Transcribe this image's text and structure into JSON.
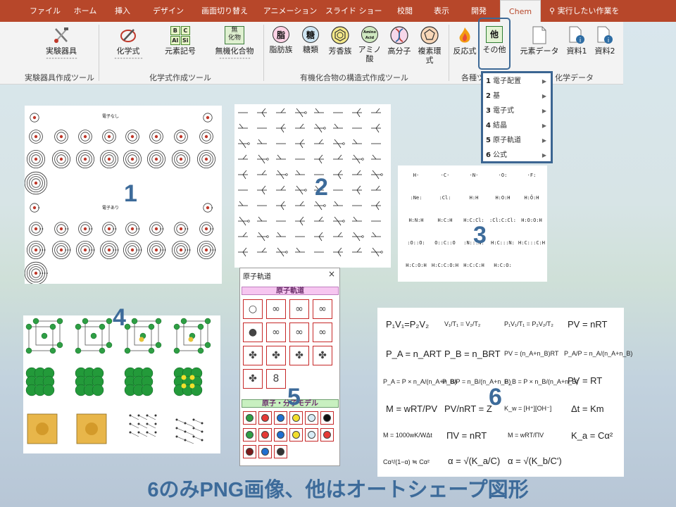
{
  "ribbon": {
    "tabs": [
      "ファイル",
      "ホーム",
      "挿入",
      "デザイン",
      "画面切り替え",
      "アニメーション",
      "スライド ショー",
      "校閲",
      "表示",
      "開発",
      "Chem"
    ],
    "active_tab": "Chem",
    "search_placeholder": "実行したい作業を",
    "buttons": {
      "lab": "実験器具",
      "formula": "化学式",
      "element_symbol": "元素記号",
      "inorganic": "無機化合物",
      "aliphatic": "脂肪族",
      "sugar": "糖類",
      "aromatic": "芳香族",
      "amino": "アミノ酸",
      "polymer": "高分子",
      "complex": "複素環式",
      "reaction": "反応式",
      "other": "その他",
      "element_data": "元素データ",
      "ref1": "資料1",
      "ref2": "資料2"
    },
    "icon_text": {
      "aliphatic": "脂",
      "sugar": "糖",
      "other": "他",
      "inorganic_top": "無",
      "inorganic_bottom": "化物",
      "element_grid": [
        "B",
        "C",
        "Al",
        "Si"
      ],
      "amino_small": "Amino Acid"
    },
    "groups": {
      "lab_group": "実験器具作成ツール",
      "formula_group": "化学式作成ツール",
      "organic_group": "有機化合物の構造式作成ツール",
      "misc_group": "各種ツ",
      "data_group": "化学データ"
    },
    "colors": {
      "tab_bar": "#b7472a",
      "accent": "#3d6b9a"
    }
  },
  "menu": {
    "items": [
      {
        "num": "1",
        "label": "電子配置"
      },
      {
        "num": "2",
        "label": "基"
      },
      {
        "num": "3",
        "label": "電子式"
      },
      {
        "num": "4",
        "label": "結晶"
      },
      {
        "num": "5",
        "label": "原子軌道"
      },
      {
        "num": "6",
        "label": "公式"
      }
    ]
  },
  "panel1": {
    "label_top": "電子なし",
    "label_bottom": "電子あり"
  },
  "lewis": {
    "rows": [
      [
        "H·",
        "·C·",
        "·N·",
        "·O:",
        "·F:"
      ],
      [
        ":Ne:",
        ":Cl:",
        "H:H",
        "H:O:H",
        "H:Ö:H"
      ],
      [
        "H:N:H",
        "H:C:H",
        "H:C:Cl:",
        ":Cl:C:Cl:",
        "H:O:O:H"
      ],
      [
        ":O::O:",
        "O::C::O",
        ":N:::N:",
        "H:C:::N:",
        "H:C:::C:H"
      ],
      [
        "H:C:O:H",
        "H:C:C:O:H",
        "H:C:C:H",
        "H:C:O:"
      ]
    ]
  },
  "orbital": {
    "title": "原子軌道",
    "close": "×",
    "section1": "原子軌道",
    "section2": "原子・分子モデル",
    "glyphs": [
      "○",
      "∞",
      "∞",
      "∞",
      "●",
      "∞",
      "∞",
      "∞",
      "✤",
      "✤",
      "✤",
      "✤",
      "✤",
      "8"
    ]
  },
  "formulas": [
    "P₁V₁=P₂V₂",
    "V₁/T₁ = V₂/T₂",
    "P₁V₁/T₁ = P₂V₂/T₂",
    "PV = nRT",
    "P_A = n_ART",
    "P_B = n_BRT",
    "PV = (n_A+n_B)RT",
    "P_A/P = n_A/(n_A+n_B)",
    "P_A = P × n_A/(n_A+n_B)",
    "P_B/P = n_B/(n_A+n_B)",
    "P_B = P × n_B/(n_A+n_B)",
    "PV = RT",
    "M = wRT/PV",
    "PV/nRT = Z",
    "K_w = [H⁺][OH⁻]",
    "Δt = Km",
    "M = 1000wK/WΔt",
    "ΠV = nRT",
    "M = wRT/ΠV",
    "K_a = Cα²",
    "Cα²/(1−α) ≒ Cα²",
    "α = √(K_a/C)",
    "α = √(K_b/C')"
  ],
  "numbers": [
    "1",
    "2",
    "3",
    "4",
    "5",
    "6"
  ],
  "caption": "6のみPNG画像、他はオートシェープ図形"
}
